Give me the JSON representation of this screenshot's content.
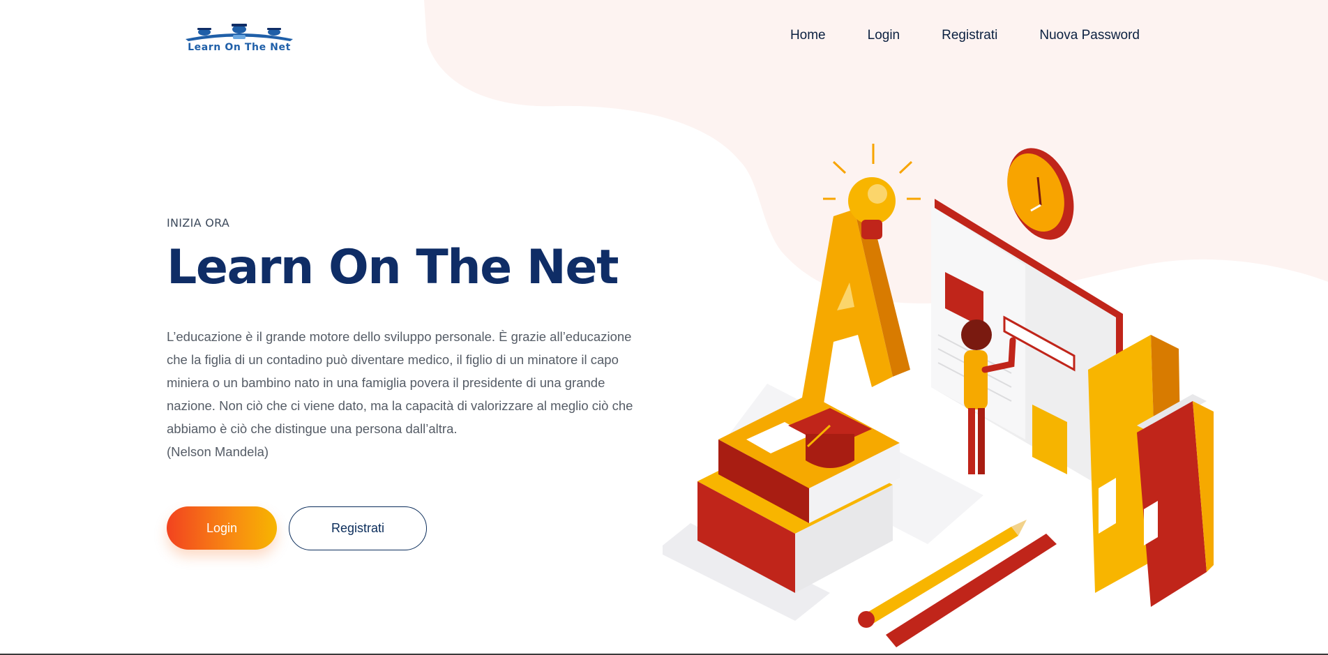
{
  "brand": {
    "logo_text": "Learn On The Net",
    "logo_icon": "graduates-icon"
  },
  "nav": {
    "items": [
      {
        "label": "Home"
      },
      {
        "label": "Login"
      },
      {
        "label": "Registrati"
      },
      {
        "label": "Nuova Password"
      }
    ]
  },
  "hero": {
    "eyebrow": "INIZIA ORA",
    "title": "Learn On The Net",
    "quote": "L’educazione è il grande motore dello sviluppo personale. È grazie all’educazione che la figlia di un contadino può diventare medico, il figlio di un minatore il capo miniera o un bambino nato in una famiglia povera il presidente di una grande nazione. Non ciò che ci viene dato, ma la capacità di valorizzare al meglio ciò che abbiamo è ciò che distingue una persona dall’altra.",
    "author": "(Nelson Mandela)",
    "login_button": "Login",
    "register_button": "Registrati"
  },
  "colors": {
    "brand_navy": "#0f2d66",
    "accent_orange": "#f2431f",
    "accent_yellow": "#f7b500",
    "blob_pink": "#fdf3f1",
    "illustration_red": "#c0251a"
  },
  "illustration": {
    "icon": "education-isometric-illustration"
  }
}
